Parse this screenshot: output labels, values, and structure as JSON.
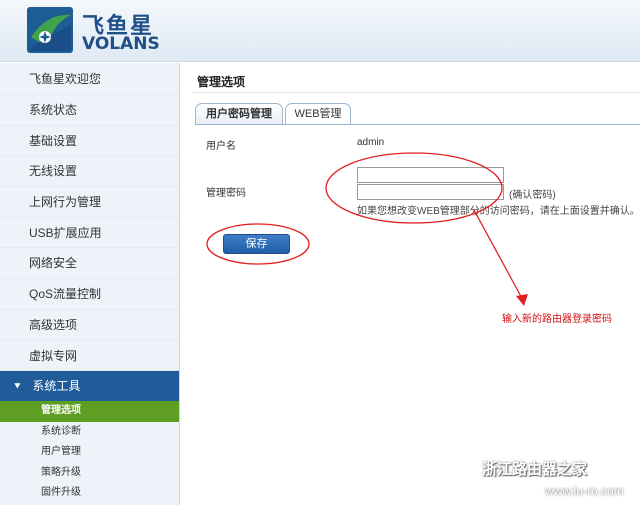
{
  "brand": {
    "name_cn": "飞鱼星",
    "name_en": "VOLANS"
  },
  "sidebar": {
    "items": [
      {
        "label": "飞鱼星欢迎您"
      },
      {
        "label": "系统状态"
      },
      {
        "label": "基础设置"
      },
      {
        "label": "无线设置"
      },
      {
        "label": "上网行为管理"
      },
      {
        "label": "USB扩展应用"
      },
      {
        "label": "网络安全"
      },
      {
        "label": "QoS流量控制"
      },
      {
        "label": "高级选项"
      },
      {
        "label": "虚拟专网"
      }
    ],
    "section": {
      "label": "系统工具",
      "icon": "double-chevron-down-icon"
    },
    "sub_items": [
      {
        "label": "管理选项",
        "active": true
      },
      {
        "label": "系统诊断"
      },
      {
        "label": "用户管理"
      },
      {
        "label": "策略升级"
      },
      {
        "label": "固件升级"
      }
    ]
  },
  "main": {
    "title": "管理选项",
    "tabs": [
      {
        "label": "用户密码管理",
        "active": true
      },
      {
        "label": "WEB管理"
      }
    ],
    "form": {
      "username_label": "用户名",
      "username_value": "admin",
      "password_label": "管理密码",
      "password_value": "",
      "confirm_value": "",
      "confirm_note": "(确认密码)",
      "hint": "如果您想改变WEB管理部分的访问密码，请在上面设置并确认。",
      "save_label": "保存"
    }
  },
  "annotation": {
    "text": "输入新的路由器登录密码",
    "color": "#d01010"
  },
  "watermark": {
    "text": "浙江路由器之家",
    "sub": "www.lu-ro.com"
  },
  "colors": {
    "nav_section": "#1f5c99",
    "active_sub": "#5e9e22",
    "brand": "#1e4f86",
    "button": "#1f5ea8"
  }
}
